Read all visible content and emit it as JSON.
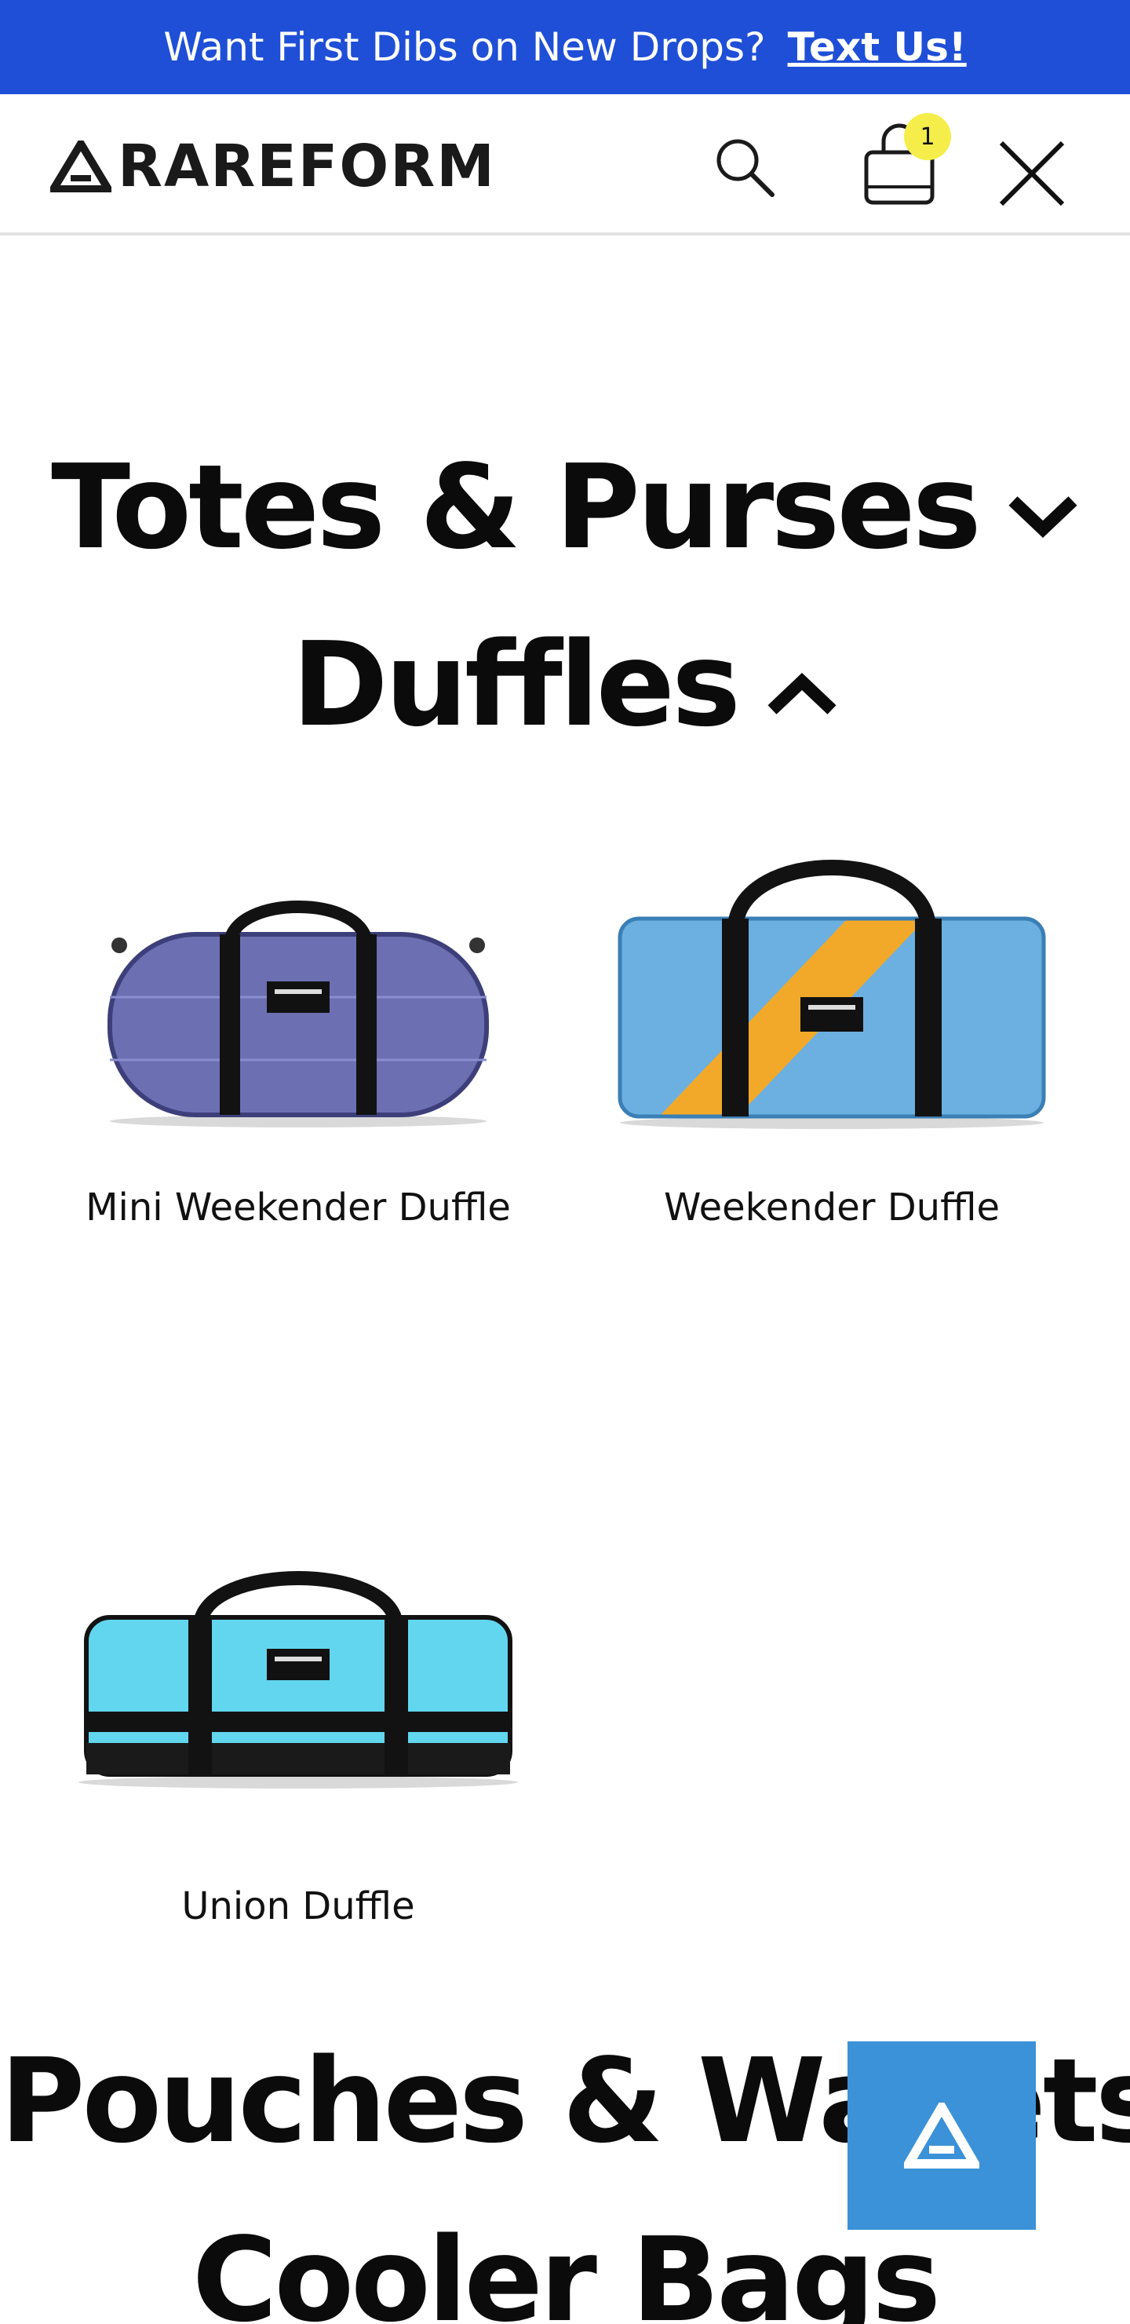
{
  "promo": {
    "text": "Want First Dibs on New Drops?",
    "link": "Text Us!"
  },
  "header": {
    "brand": "RAREFORM",
    "cart_count": "1"
  },
  "categories": [
    {
      "label": "Totes & Purses",
      "state": "collapsed"
    },
    {
      "label": "Duffles",
      "state": "expanded"
    },
    {
      "label": "Pouches & Wallets",
      "state": "collapsed"
    },
    {
      "label": "Cooler Bags",
      "state": "collapsed"
    }
  ],
  "products": [
    {
      "name": "Mini Weekender Duffle"
    },
    {
      "name": "Weekender Duffle"
    },
    {
      "name": "Union Duffle"
    }
  ],
  "icons": {
    "search": "search-icon",
    "cart": "shopping-bag-icon",
    "close": "close-icon",
    "chevron_down": "chevron-down-icon",
    "chevron_up": "chevron-up-icon",
    "chat": "rareform-logo-icon"
  },
  "colors": {
    "promo_bg": "#1f4fd6",
    "cart_badge": "#f5ee4a",
    "chat_button": "#3b92d8"
  }
}
